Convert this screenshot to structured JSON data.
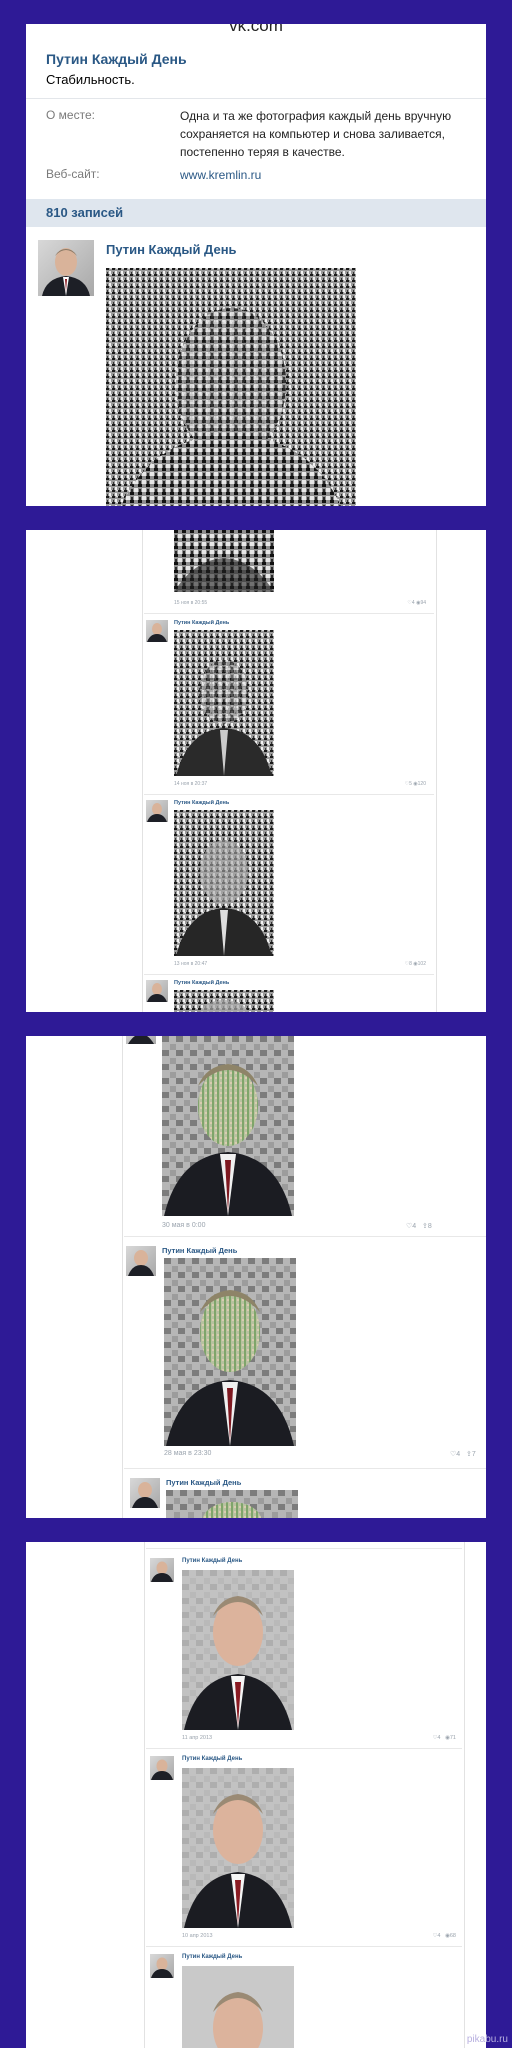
{
  "panel1": {
    "site": "vk.com",
    "page_title": "Путин Каждый День",
    "status": "Стабильность.",
    "info": [
      {
        "label": "О месте:",
        "value": "Одна и та же фотография каждый день вручную сохраняется на компьютер и снова заливается, постепенно теряя в качестве."
      },
      {
        "label": "Веб-сайт:",
        "value": "www.kremlin.ru"
      }
    ],
    "posts_count": "810 записей",
    "post_author": "Путин Каждый День"
  },
  "panel2": {
    "author": "Путин Каждый День",
    "posts": [
      {
        "date": "15 ноя в 20:55",
        "likes": "4",
        "views": "94"
      },
      {
        "date": "14 ноя в 20:37",
        "likes": "5",
        "views": "120"
      },
      {
        "date": "13 ноя в 20:47",
        "likes": "8",
        "views": "102"
      }
    ]
  },
  "panel3": {
    "author": "Путин Каждый День",
    "posts": [
      {
        "date": "30 мая в 0:00",
        "likes": "4",
        "views": "8"
      },
      {
        "date": "28 мая в 23:30",
        "likes": "4",
        "views": "7"
      }
    ]
  },
  "panel4": {
    "author": "Путин Каждый День",
    "posts": [
      {
        "date": "11 апр 2013",
        "likes": "4",
        "views": "71"
      },
      {
        "date": "10 апр 2013",
        "likes": "4",
        "views": "68"
      }
    ]
  },
  "footer": "pikabu.ru",
  "colors": {
    "background": "#2e1a96",
    "link": "#2a5885",
    "count_bar": "#dfe6ee"
  },
  "icons": {
    "like": "heart-icon",
    "views": "eye-icon",
    "share": "share-icon"
  }
}
